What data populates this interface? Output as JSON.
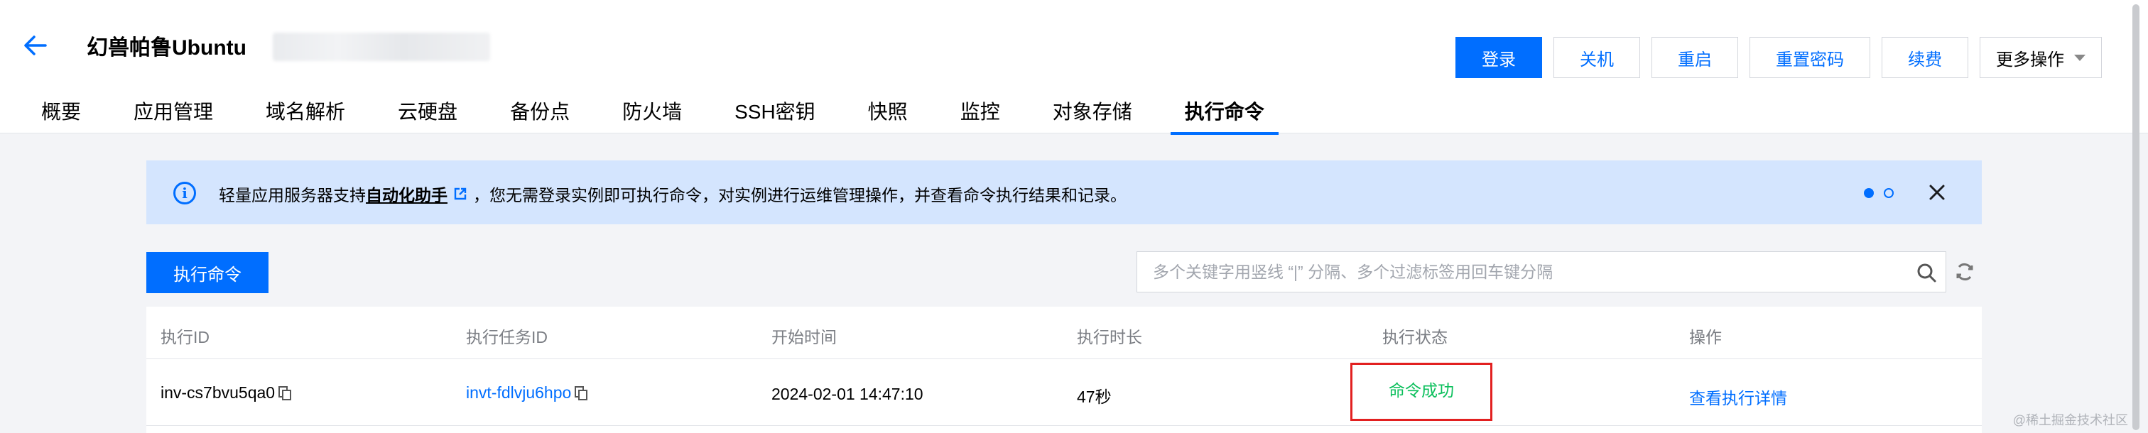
{
  "header": {
    "title": "幻兽帕鲁Ubuntu",
    "actions": [
      {
        "label": "登录"
      },
      {
        "label": "关机"
      },
      {
        "label": "重启"
      },
      {
        "label": "重置密码"
      },
      {
        "label": "续费"
      }
    ],
    "more_label": "更多操作"
  },
  "tabs": [
    {
      "label": "概要"
    },
    {
      "label": "应用管理"
    },
    {
      "label": "域名解析"
    },
    {
      "label": "云硬盘"
    },
    {
      "label": "备份点"
    },
    {
      "label": "防火墙"
    },
    {
      "label": "SSH密钥"
    },
    {
      "label": "快照"
    },
    {
      "label": "监控"
    },
    {
      "label": "对象存储"
    },
    {
      "label": "执行命令",
      "active": true
    }
  ],
  "banner": {
    "text_before": "轻量应用服务器支持",
    "link": "自动化助手",
    "text_after": "，您无需登录实例即可执行命令，对实例进行运维管理操作，并查看命令执行结果和记录。"
  },
  "toolbar": {
    "execute_label": "执行命令",
    "search_placeholder": "多个关键字用竖线 “|” 分隔、多个过滤标签用回车键分隔"
  },
  "table": {
    "columns": [
      "执行ID",
      "执行任务ID",
      "开始时间",
      "执行时长",
      "执行状态",
      "操作"
    ],
    "rows": [
      {
        "exec_id": "inv-cs7bvu5qa0",
        "task_id": "invt-fdlvju6hpo",
        "start_time": "2024-02-01 14:47:10",
        "duration": "47秒",
        "status": "命令成功",
        "action": "查看执行详情"
      }
    ]
  },
  "watermark": "@稀土掘金技术社区",
  "colors": {
    "accent": "#006eff",
    "success": "#0abf5b",
    "highlight_box": "#e22020",
    "banner_bg": "#d4e5fe"
  }
}
